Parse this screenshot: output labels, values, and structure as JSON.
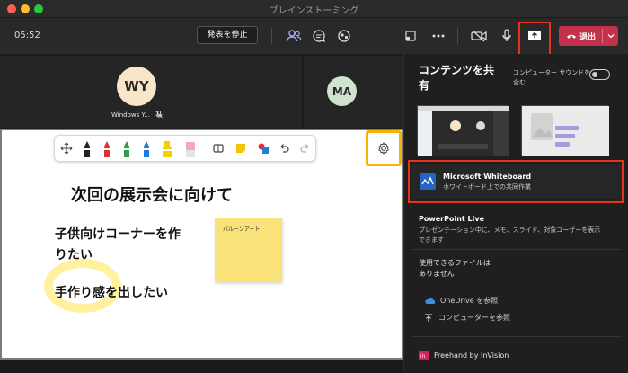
{
  "window": {
    "title": "ブレインストーミング"
  },
  "toolbar": {
    "timer": "05:52",
    "stop_presenting_label": "発表を停止",
    "leave_label": "退出"
  },
  "participants": [
    {
      "initials": "WY",
      "name": "Windows Y...",
      "avatar_color": "#f8e6c8"
    },
    {
      "initials": "MA",
      "avatar_color": "#cfe3cf"
    }
  ],
  "whiteboard": {
    "title": "次回の展示会に向けて",
    "line1": "子供向けコーナーを作",
    "line2": "りたい",
    "line3": "手作り感を出したい",
    "sticky_note": "バルーンアート",
    "pen_colors": [
      "#222222",
      "#e03131",
      "#2f9e44",
      "#1c7ed6",
      "#f5d000",
      "#f2a7c4"
    ]
  },
  "share_panel": {
    "title_line1": "コンテンツを共",
    "title_line2": "有",
    "sound_label_line1": "コンピューター サウンドを",
    "sound_label_line2": "含む",
    "options": {
      "whiteboard": {
        "title": "Microsoft Whiteboard",
        "subtitle": "ホワイトボード上での共同作業"
      },
      "powerpoint": {
        "title": "PowerPoint Live",
        "subtitle_line1": "プレゼンテーション中に、メモ、スライド、対象ユーザーを表示",
        "subtitle_line2": "できます"
      },
      "files": {
        "line1": "使用できるファイルは",
        "line2": "ありません"
      }
    },
    "onedrive_label": "OneDrive を参照",
    "computer_label": "コンピューターを参照",
    "freehand_label": "Freehand by InVision"
  },
  "colors": {
    "leave": "#c4314b",
    "highlight_box": "#e8321b",
    "settings_box": "#f5b400"
  }
}
